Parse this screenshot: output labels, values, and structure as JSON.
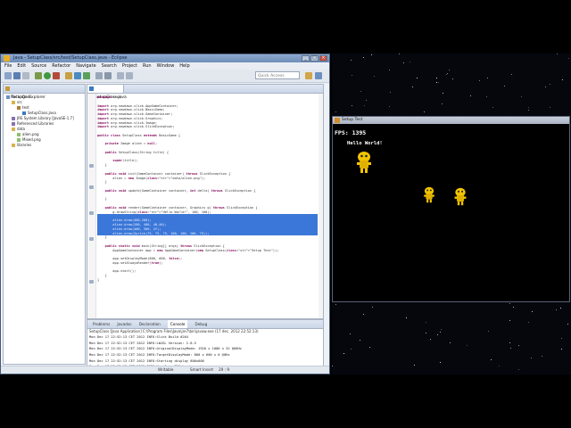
{
  "colors": {
    "selection": "#3b77d8",
    "keyword": "#7f0055",
    "string": "#2a00ff",
    "alien": "#f2c400"
  },
  "eclipse": {
    "title": "Java - SetupClass/src/test/SetupClass.java - Eclipse",
    "menu": [
      "File",
      "Edit",
      "Source",
      "Refactor",
      "Navigate",
      "Search",
      "Project",
      "Run",
      "Window",
      "Help"
    ],
    "quick_access": "Quick Access"
  },
  "package_explorer": {
    "tab": "Package Explorer",
    "tree": [
      {
        "label": "SetupClass",
        "icon": "project-icon",
        "depth": 0
      },
      {
        "label": "src",
        "icon": "folder-icon",
        "depth": 1
      },
      {
        "label": "test",
        "icon": "package-icon",
        "depth": 2
      },
      {
        "label": "SetupClass.java",
        "icon": "java-file-icon",
        "depth": 3
      },
      {
        "label": "JRE System Library [JavaSE-1.7]",
        "icon": "library-icon",
        "depth": 1
      },
      {
        "label": "Referenced Libraries",
        "icon": "library-icon",
        "depth": 1
      },
      {
        "label": "data",
        "icon": "folder-icon",
        "depth": 1
      },
      {
        "label": "alien.png",
        "icon": "image-file-icon",
        "depth": 2
      },
      {
        "label": "Mixed.png",
        "icon": "image-file-icon",
        "depth": 2
      },
      {
        "label": "libraries",
        "icon": "folder-icon",
        "depth": 1
      }
    ]
  },
  "editor": {
    "tab": "SetupClass.java",
    "lines": [
      "package test;",
      "",
      "import org.newdawn.slick.AppGameContainer;",
      "import org.newdawn.slick.BasicGame;",
      "import org.newdawn.slick.GameContainer;",
      "import org.newdawn.slick.Graphics;",
      "import org.newdawn.slick.Image;",
      "import org.newdawn.slick.SlickException;",
      "",
      "public class SetupClass extends BasicGame {",
      "",
      "    private Image alien = null;",
      "",
      "    public SetupClass(String title) {",
      "",
      "        super(title);",
      "    }",
      "",
      "    public void init(GameContainer container) throws SlickException {",
      "        alien = new Image(\"data/alien.png\");",
      "    }",
      "",
      "    public void update(GameContainer container, int delta) throws SlickException {",
      "",
      "    }",
      "",
      "    public void render(GameContainer container, Graphics g) throws SlickException {",
      "        g.drawString(\"Hello World!\", 100, 100);",
      "",
      "        alien.draw(400,200);",
      "        alien.draw(200, 400, 40,40);",
      "        alien.draw(400, 300, 2f);",
      "        alien.draw(Sprite(75, 75, 75, 100, 100, 100, 75));",
      "    }",
      "",
      "    public static void main(String[] args) throws SlickException {",
      "        AppGameContainer app = new AppGameContainer(new SetupClass(\"Setup Test\"));",
      "",
      "        app.setDisplayMode(800, 600, false);",
      "        app.setAlwaysRender(true);",
      "",
      "        app.start();",
      "    }",
      "}"
    ],
    "selected_lines": [
      28,
      29,
      30,
      31,
      32
    ]
  },
  "console": {
    "tabs": [
      "Problems",
      "Javadoc",
      "Declaration",
      "Console",
      "Debug"
    ],
    "active_tab": "Console",
    "terminated": "SetupClass [Java Application] C:\\Program Files\\Java\\jre7\\bin\\javaw.exe (17 dec. 2012 22:52:13)",
    "lines": [
      "Mon Dec 17 22:52:13 CET 2012 INFO:Slick Build #264",
      "Mon Dec 17 22:52:13 CET 2012 INFO:LWJGL Version: 2.8.5",
      "Mon Dec 17 22:52:13 CET 2012 INFO:OriginalDisplayMode: 1920 x 1080 x 32 @60Hz",
      "Mon Dec 17 22:52:13 CET 2012 INFO:TargetDisplayMode: 800 x 600 x 0 @0Hz",
      "Mon Dec 17 22:52:13 CET 2012 INFO:Starting display 800x600",
      "Mon Dec 17 22:52:13 CET 2012 INFO:Use Java PNG Loader = true",
      "Mon Dec 17 22:52:13 CET 2012 INFO:Controllers not available"
    ]
  },
  "status_bar": {
    "writable": "Writable",
    "insert": "Smart Insert",
    "position": "29 : 9"
  },
  "game": {
    "title": "Setup Test",
    "fps": "FPS: 1395",
    "hello": "Hello World!"
  }
}
